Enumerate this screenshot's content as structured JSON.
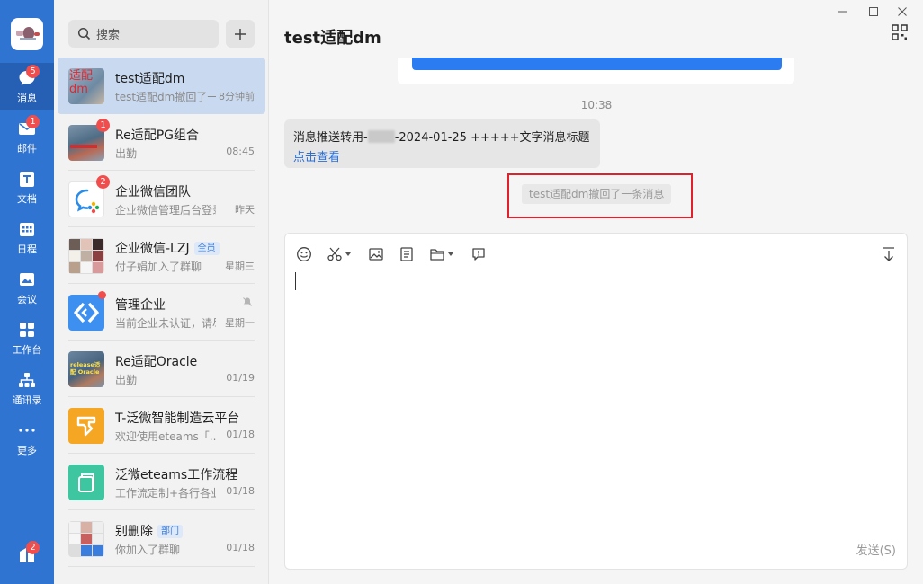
{
  "rail": {
    "items": [
      {
        "label": "消息",
        "badge": "5",
        "icon": "chat-bubble-icon"
      },
      {
        "label": "邮件",
        "badge": "1",
        "icon": "mail-icon"
      },
      {
        "label": "文档",
        "badge": "",
        "icon": "document-icon"
      },
      {
        "label": "日程",
        "badge": "",
        "icon": "calendar-icon"
      },
      {
        "label": "会议",
        "badge": "",
        "icon": "meeting-icon"
      },
      {
        "label": "工作台",
        "badge": "",
        "icon": "workbench-icon"
      },
      {
        "label": "通讯录",
        "badge": "",
        "icon": "contacts-icon"
      },
      {
        "label": "更多",
        "badge": "",
        "icon": "more-icon"
      }
    ],
    "bottom_badge": "2"
  },
  "list": {
    "search_placeholder": "搜索",
    "conversations": [
      {
        "name": "test适配dm",
        "preview": "test适配dm撤回了一条消息",
        "time": "8分钟前",
        "badge": "",
        "avatar_text": "适配dm"
      },
      {
        "name": "Re适配PG组合",
        "preview": "出勤",
        "time": "08:45",
        "badge": "1"
      },
      {
        "name": "企业微信团队",
        "preview": "企业微信管理后台登录提醒",
        "time": "昨天",
        "badge": "2"
      },
      {
        "name": "企业微信-LZJ",
        "tag": "全员",
        "preview": "付子娟加入了群聊",
        "time": "星期三",
        "badge": ""
      },
      {
        "name": "管理企业",
        "preview": "当前企业未认证，请尽快认证",
        "time": "星期一",
        "badge": "dot"
      },
      {
        "name": "Re适配Oracle",
        "preview": "出勤",
        "time": "01/19",
        "badge": "",
        "avatar_text": "release适配 Oracle"
      },
      {
        "name": "T-泛微智能制造云平台",
        "preview": "欢迎使用eteams「...」",
        "time": "01/18",
        "badge": ""
      },
      {
        "name": "泛微eteams工作流程",
        "preview": "工作流定制+各行各业",
        "time": "01/18",
        "badge": ""
      },
      {
        "name": "别删除",
        "tag": "部门",
        "preview": "你加入了群聊",
        "time": "01/18",
        "badge": ""
      }
    ]
  },
  "chat": {
    "title": "test适配dm",
    "timestamp": "10:38",
    "message_line1_pre": "消息推送转用-",
    "message_line1_post": "-2024-01-25 +++++文字消息标题",
    "message_link": "点击查看",
    "recall_notice": "test适配dm撤回了一条消息",
    "send_label": "发送(S)"
  },
  "colors": {
    "rail_bg": "#2f74d0",
    "badge_red": "#f24d4d",
    "link_blue": "#2b6fd6",
    "highlight_box": "#e0202a"
  }
}
